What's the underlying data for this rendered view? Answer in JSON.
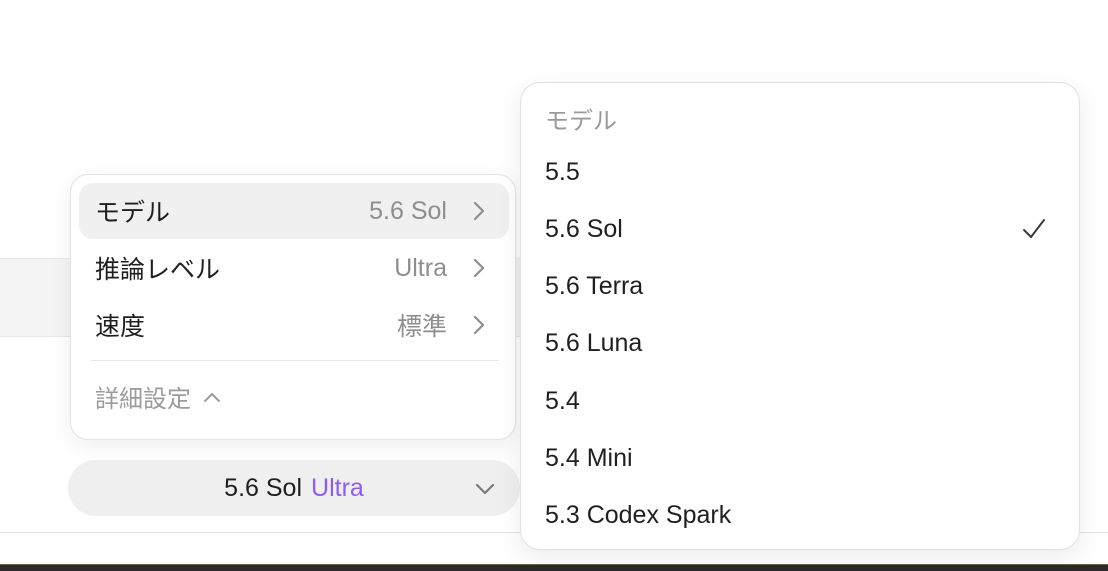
{
  "settings_menu": {
    "rows": [
      {
        "label": "モデル",
        "value": "5.6 Sol"
      },
      {
        "label": "推論レベル",
        "value": "Ultra"
      },
      {
        "label": "速度",
        "value": "標準"
      }
    ],
    "advanced_label": "詳細設定"
  },
  "model_selector": {
    "model": "5.6 Sol",
    "level": "Ultra",
    "level_color": "#8b5cf6"
  },
  "model_submenu": {
    "header": "モデル",
    "selected": "5.6 Sol",
    "options": [
      {
        "label": "5.5"
      },
      {
        "label": "5.6 Sol"
      },
      {
        "label": "5.6 Terra"
      },
      {
        "label": "5.6 Luna"
      },
      {
        "label": "5.4"
      },
      {
        "label": "5.4 Mini"
      },
      {
        "label": "5.3 Codex Spark"
      }
    ]
  },
  "icons": {
    "row_chevron": "chevron-right-icon",
    "advanced_chevron": "chevron-up-icon",
    "pill_chevron": "chevron-down-icon",
    "selected_mark": "checkmark-icon"
  }
}
